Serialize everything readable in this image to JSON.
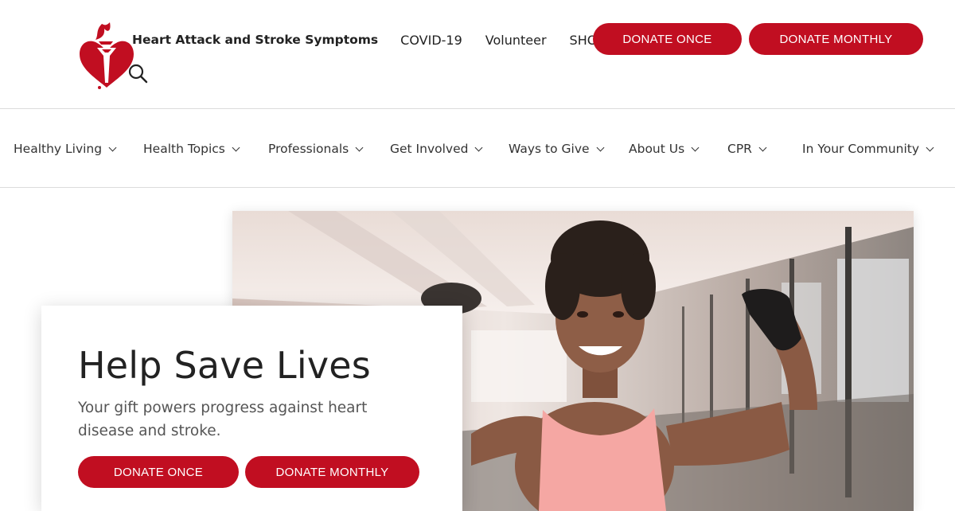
{
  "header": {
    "logo_icon": "heart-torch-logo-icon",
    "search_icon": "search-icon",
    "links": {
      "symptoms": "Heart Attack and Stroke Symptoms",
      "covid": "COVID-19",
      "volunteer": "Volunteer",
      "shop": "SHOP"
    },
    "donate_once": "DONATE ONCE",
    "donate_monthly": "DONATE MONTHLY"
  },
  "nav": {
    "items": [
      {
        "label": "Healthy Living"
      },
      {
        "label": "Health Topics"
      },
      {
        "label": "Professionals"
      },
      {
        "label": "Get Involved"
      },
      {
        "label": "Ways to Give"
      },
      {
        "label": "About Us"
      },
      {
        "label": "CPR"
      },
      {
        "label": "In Your Community"
      }
    ],
    "chevron_icon": "chevron-down-icon"
  },
  "hero": {
    "title": "Help Save Lives",
    "subtitle": "Your gift powers progress against heart disease and stroke.",
    "donate_once": "DONATE ONCE",
    "donate_monthly": "DONATE MONTHLY",
    "image_subject": "smiling woman flexing arm in gym"
  },
  "colors": {
    "brand_red": "#c10e21",
    "text_dark": "#222222",
    "text_muted": "#555555",
    "divider": "#dcdcdc"
  }
}
